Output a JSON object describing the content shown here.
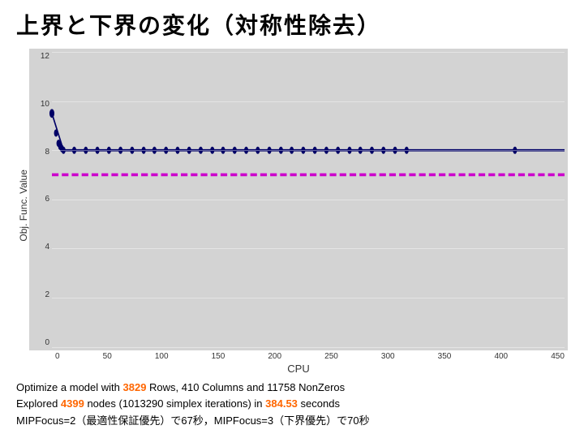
{
  "title": "上界と下界の変化（対称性除去）",
  "chart": {
    "y_label": "Obj. Func. Value",
    "x_label": "CPU",
    "y_ticks": [
      "12",
      "10",
      "8",
      "6",
      "4",
      "2",
      "0"
    ],
    "x_ticks": [
      "0",
      "50",
      "100",
      "150",
      "200",
      "250",
      "300",
      "350",
      "400",
      "450"
    ]
  },
  "info": {
    "line1_pre": "Optimize a model with ",
    "line1_num1": "3829",
    "line1_mid": " Rows, 410 Columns and 11758 NonZeros",
    "line2_pre": "Explored ",
    "line2_num1": "4399",
    "line2_mid": " nodes (1013290 simplex iterations) in ",
    "line2_num2": "384.53",
    "line2_post": " seconds",
    "line3": "MIPFocus=2（最適性保証優先）で67秒，MIPFocus=3（下界優先）で70秒"
  }
}
